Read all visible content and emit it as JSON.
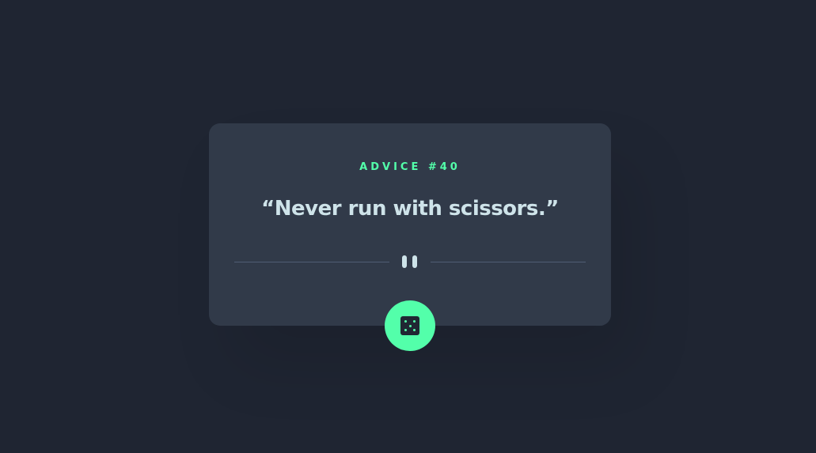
{
  "card": {
    "advice_label": "ADVICE #40",
    "quote": "“Never run with scissors.”"
  },
  "icons": {
    "divider": "pause-icon",
    "button": "dice-icon"
  },
  "colors": {
    "background": "#1f2532",
    "card": "#313a49",
    "accent": "#53ffaa",
    "text": "#cee3e9",
    "divider": "#4f5d74"
  }
}
